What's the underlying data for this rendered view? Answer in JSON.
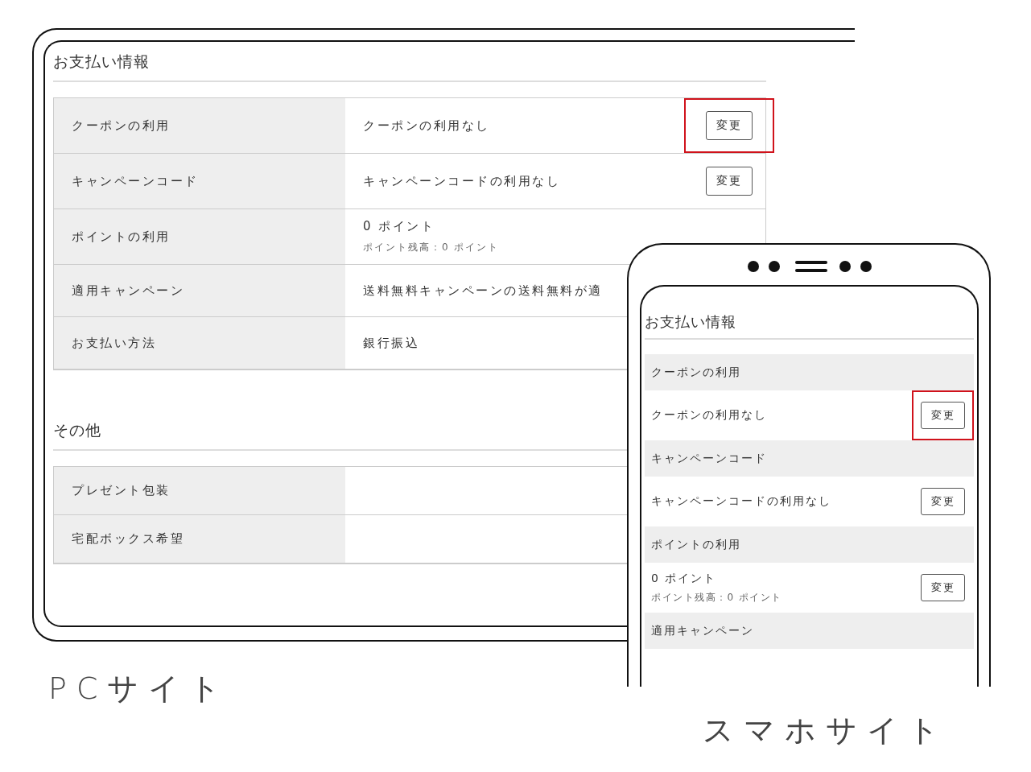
{
  "pc_site": {
    "sections": [
      {
        "title": "お支払い情報",
        "rows": [
          {
            "label": "クーポンの利用",
            "value": "クーポンの利用なし",
            "button": {
              "label": "変更",
              "highlighted": true
            }
          },
          {
            "label": "キャンペーンコード",
            "value": "キャンペーンコードの利用なし",
            "button": {
              "label": "変更",
              "highlighted": false
            }
          },
          {
            "label": "ポイントの利用",
            "value": "0 ポイント",
            "note": "ポイント残高：0 ポイント"
          },
          {
            "label": "適用キャンペーン",
            "value": "送料無料キャンペーンの送料無料が適"
          },
          {
            "label": "お支払い方法",
            "value": "銀行振込"
          }
        ]
      },
      {
        "title": "その他",
        "rows": [
          {
            "label": "プレゼント包装"
          },
          {
            "label": "宅配ボックス希望"
          }
        ]
      }
    ],
    "caption": "PCサイト"
  },
  "smartphone_site": {
    "title": "お支払い情報",
    "rows": [
      {
        "label": "クーポンの利用",
        "value": "クーポンの利用なし",
        "button": {
          "label": "変更",
          "highlighted": true
        }
      },
      {
        "label": "キャンペーンコード",
        "value": "キャンペーンコードの利用なし",
        "button": {
          "label": "変更",
          "highlighted": false
        }
      },
      {
        "label": "ポイントの利用",
        "value": "0 ポイント",
        "note": "ポイント残高：0 ポイント",
        "button": {
          "label": "変更",
          "highlighted": false
        }
      },
      {
        "label": "適用キャンペーン"
      }
    ],
    "caption": "スマホサイト"
  }
}
